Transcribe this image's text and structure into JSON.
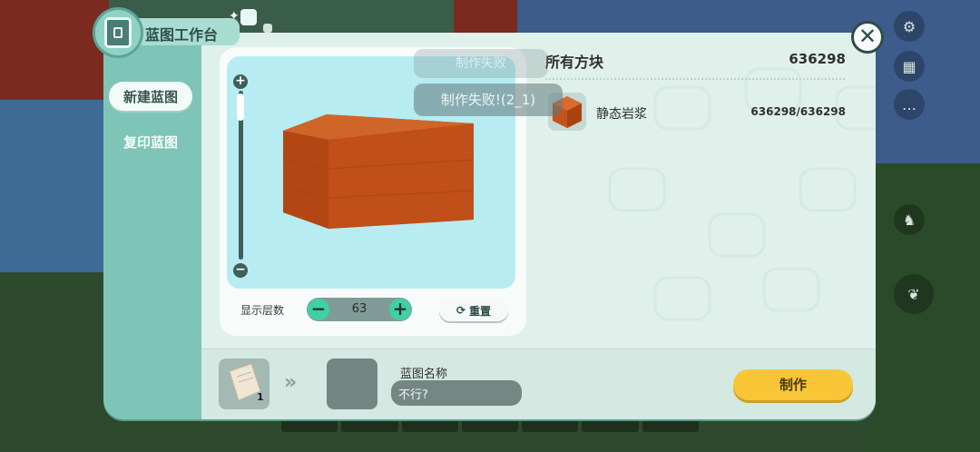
{
  "app": {
    "title": "蓝图工作台"
  },
  "sidebar": {
    "items": [
      {
        "label": "新建蓝图",
        "active": true
      },
      {
        "label": "复印蓝图",
        "active": false
      }
    ]
  },
  "preview": {
    "layers_label": "显示层数",
    "layers_value": "63",
    "minus_symbol": "−",
    "plus_symbol": "+",
    "reset_label": "重置",
    "slider_plus": "+",
    "slider_minus": "−"
  },
  "blocks": {
    "header": "所有方块",
    "total": "636298",
    "items": [
      {
        "name": "静态岩浆",
        "count": "636298/636298"
      }
    ]
  },
  "toasts": {
    "faded": "制作失败",
    "message": "制作失败!(2_1)"
  },
  "bottom": {
    "paper_count": "1",
    "name_label": "蓝图名称",
    "name_value": "不行?",
    "make_label": "制作"
  },
  "close_symbol": "✕",
  "colors": {
    "panel": "#7fc5b7",
    "content": "#dff1ea",
    "accent_green": "#3fd1a3",
    "make_button": "#f8c636",
    "lava": "#c2531c"
  },
  "icons": [
    "blueprint-icon",
    "close-icon",
    "refresh-icon",
    "paper-icon",
    "lava-block-icon",
    "settings-icon",
    "chat-icon",
    "horse-icon",
    "wing-icon"
  ]
}
